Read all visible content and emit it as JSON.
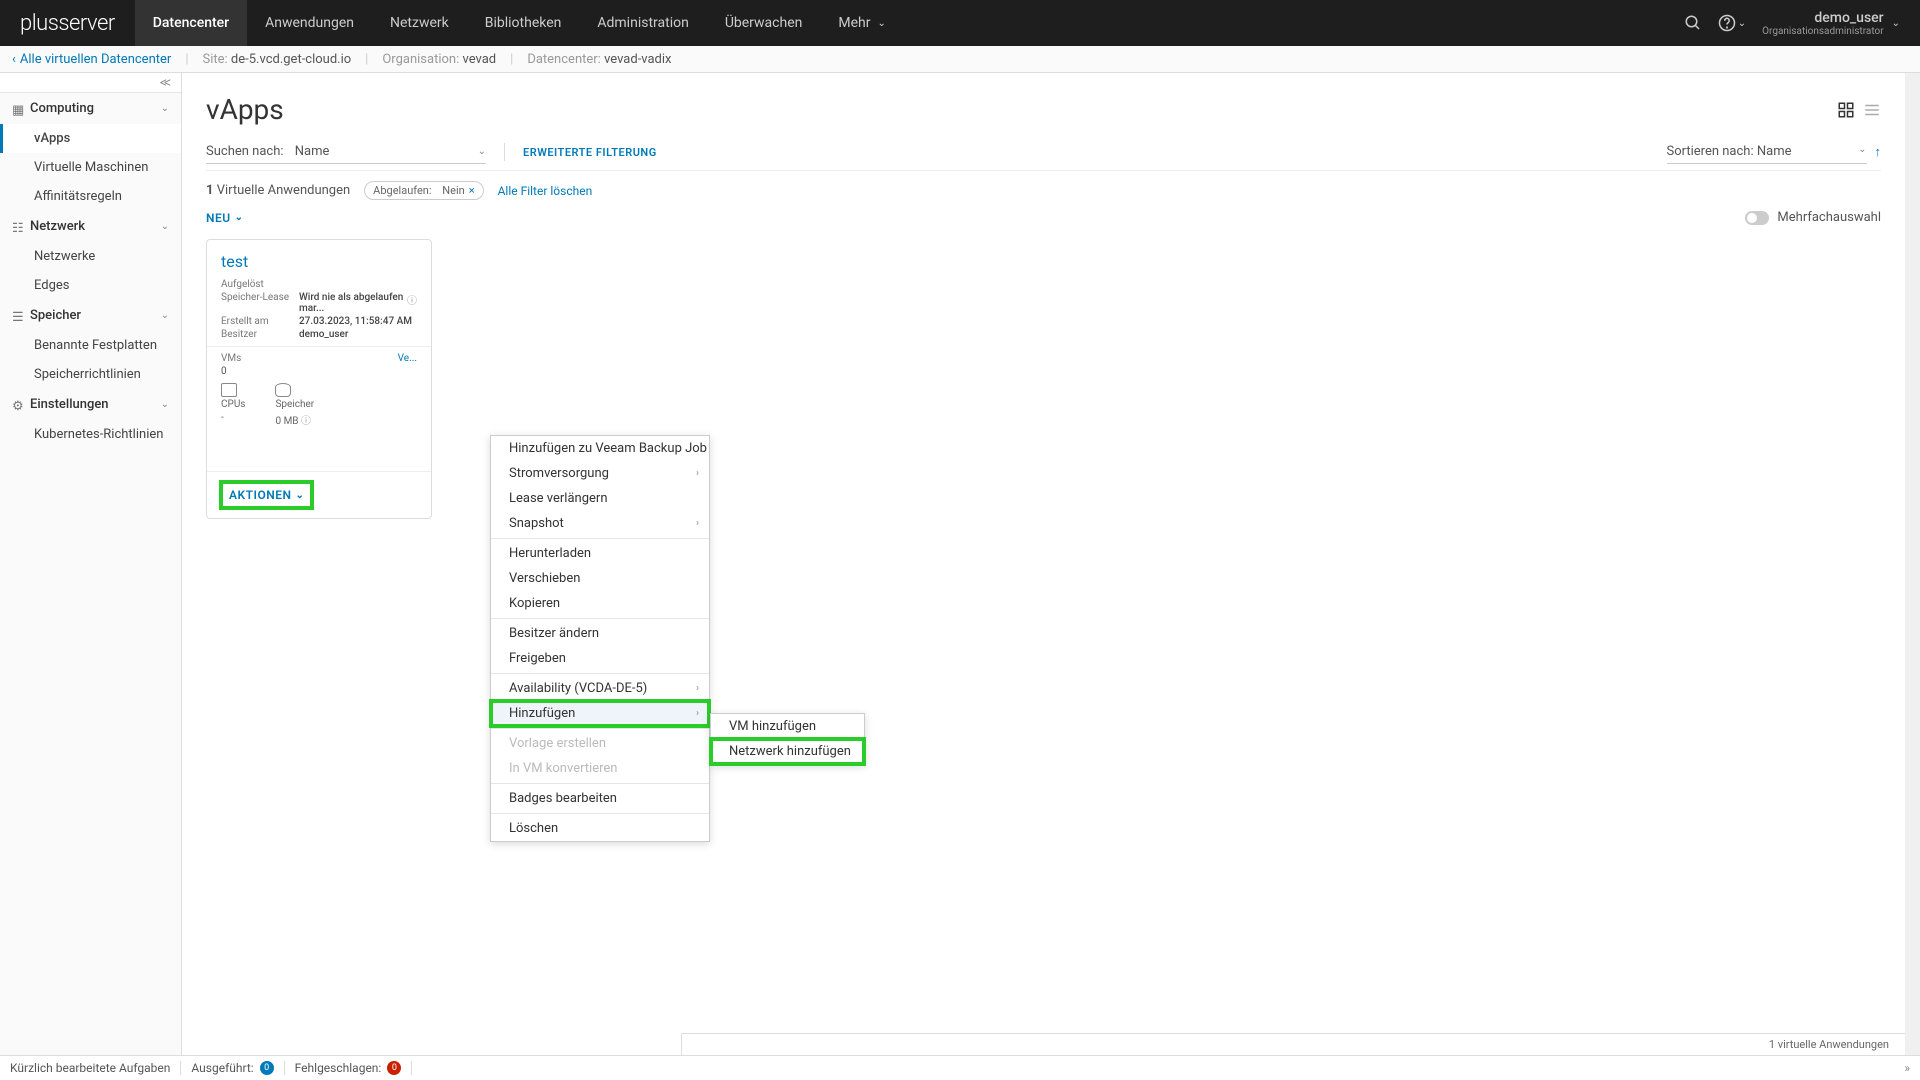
{
  "brand": "plusserver",
  "topnav": {
    "items": [
      "Datencenter",
      "Anwendungen",
      "Netzwerk",
      "Bibliotheken",
      "Administration",
      "Überwachen",
      "Mehr"
    ],
    "user": {
      "name": "demo_user",
      "role": "Organisationsadministrator"
    }
  },
  "breadcrumb": {
    "back": "Alle virtuellen Datencenter",
    "site_label": "Site:",
    "site_val": "de-5.vcd.get-cloud.io",
    "org_label": "Organisation:",
    "org_val": "vevad",
    "dc_label": "Datencenter:",
    "dc_val": "vevad-vadix"
  },
  "sidebar": {
    "groups": [
      {
        "label": "Computing",
        "items": [
          "vApps",
          "Virtuelle Maschinen",
          "Affinitätsregeln"
        ],
        "active": 0
      },
      {
        "label": "Netzwerk",
        "items": [
          "Netzwerke",
          "Edges"
        ]
      },
      {
        "label": "Speicher",
        "items": [
          "Benannte Festplatten",
          "Speicherrichtlinien"
        ]
      },
      {
        "label": "Einstellungen",
        "items": [
          "Kubernetes-Richtlinien"
        ]
      }
    ]
  },
  "page": {
    "title": "vApps",
    "search_label": "Suchen nach:",
    "search_field": "Name",
    "adv_filter": "ERWEITERTE FILTERUNG",
    "sort_label": "Sortieren nach:",
    "sort_field": "Name",
    "count_num": "1",
    "count_text": "Virtuelle Anwendungen",
    "chip_label": "Abgelaufen:",
    "chip_val": "Nein",
    "clear_filters": "Alle Filter löschen",
    "neu": "NEU",
    "multi": "Mehrfachauswahl",
    "footer_count": "1 virtuelle Anwendungen"
  },
  "card": {
    "title": "test",
    "rows": [
      {
        "k": "Aufgelöst",
        "v": ""
      },
      {
        "k": "Speicher-Lease",
        "v": "Wird nie als abgelaufen mar..."
      },
      {
        "k": "Erstellt am",
        "v": "27.03.2023, 11:58:47 AM"
      },
      {
        "k": "Besitzer",
        "v": "demo_user"
      }
    ],
    "vms_label": "VMs",
    "vms_link": "Ve...",
    "vms_count": "0",
    "cpus_label": "CPUs",
    "cpus_val": "-",
    "mem_label": "Speicher",
    "mem_val": "0 MB",
    "actions": "AKTIONEN"
  },
  "menu1": [
    {
      "t": "Hinzufügen zu Veeam Backup Job"
    },
    {
      "t": "Stromversorgung",
      "sub": true
    },
    {
      "t": "Lease verlängern"
    },
    {
      "t": "Snapshot",
      "sub": true
    },
    {
      "sep": true
    },
    {
      "t": "Herunterladen"
    },
    {
      "t": "Verschieben"
    },
    {
      "t": "Kopieren"
    },
    {
      "sep": true
    },
    {
      "t": "Besitzer ändern"
    },
    {
      "t": "Freigeben"
    },
    {
      "sep": true
    },
    {
      "t": "Availability (VCDA-DE-5)",
      "sub": true
    },
    {
      "t": "Hinzufügen",
      "sub": true,
      "hl": true,
      "hover": true
    },
    {
      "sep": true
    },
    {
      "t": "Vorlage erstellen",
      "disabled": true
    },
    {
      "t": "In VM konvertieren",
      "disabled": true
    },
    {
      "sep": true
    },
    {
      "t": "Badges bearbeiten"
    },
    {
      "sep": true
    },
    {
      "t": "Löschen"
    }
  ],
  "menu2": [
    {
      "t": "VM hinzufügen"
    },
    {
      "t": "Netzwerk hinzufügen",
      "hl": true
    }
  ],
  "status": {
    "recent": "Kürzlich bearbeitete Aufgaben",
    "running_label": "Ausgeführt:",
    "running_val": "0",
    "failed_label": "Fehlgeschlagen:",
    "failed_val": "0"
  }
}
